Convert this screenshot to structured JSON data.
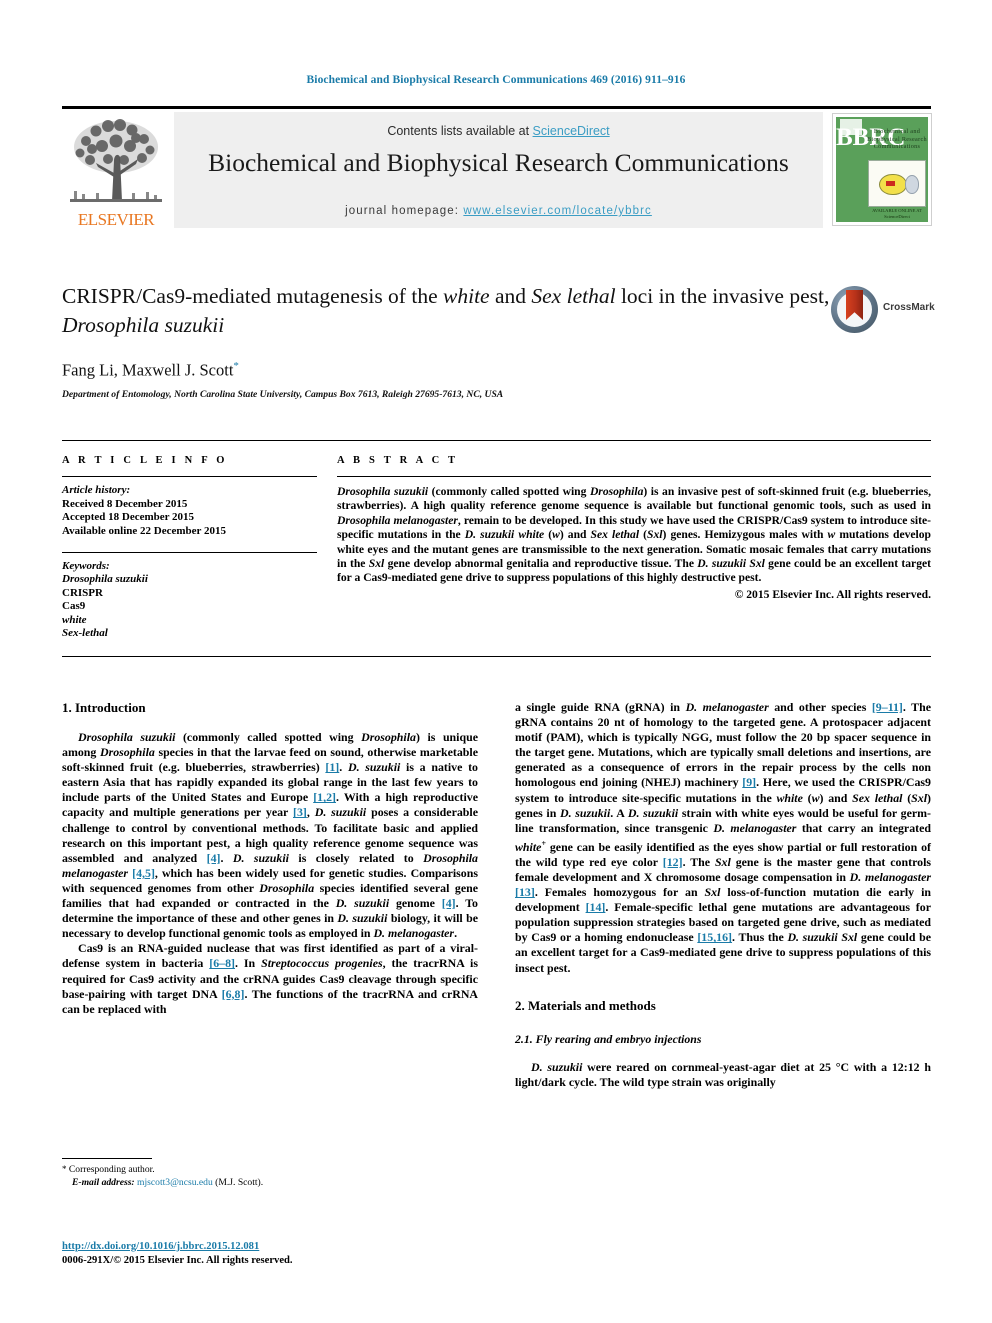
{
  "running_head": "Biochemical and Biophysical Research Communications 469 (2016) 911–916",
  "masthead": {
    "contents_prefix": "Contents lists available at ",
    "sciencedirect": "ScienceDirect",
    "journal_title": "Biochemical and Biophysical Research Communications",
    "homepage_label": "journal homepage:",
    "homepage_url": "www.elsevier.com/locate/ybbrc",
    "publisher_logo_text": "ELSEVIER",
    "cover": {
      "letters": "BBRC",
      "name": "Biochemical and Biophysical Research Communications",
      "footer": "AVAILABLE ONLINE AT\nScienceDirect"
    },
    "accent_color": "#3b9dc4",
    "brand_color": "#e87722"
  },
  "title_block": {
    "title_part1": "CRISPR/Cas9-mediated mutagenesis of the ",
    "title_italic1": "white",
    "title_part2": " and ",
    "title_italic2": "Sex lethal",
    "title_part3": " loci in the invasive pest, ",
    "title_italic3": "Drosophila suzukii",
    "authors": "Fang Li, Maxwell J. Scott",
    "author_marker": "*",
    "affiliation": "Department of Entomology, North Carolina State University, Campus Box 7613, Raleigh 27695-7613, NC, USA",
    "crossmark_label": "CrossMark"
  },
  "article_info": {
    "label": "A R T I C L E    I N F O",
    "history_label": "Article history:",
    "history": [
      "Received 8 December 2015",
      "Accepted 18 December 2015",
      "Available online 22 December 2015"
    ],
    "keywords_label": "Keywords:",
    "keywords": [
      {
        "text": "Drosophila suzukii",
        "italic": true
      },
      {
        "text": "CRISPR",
        "italic": false
      },
      {
        "text": "Cas9",
        "italic": false
      },
      {
        "text": "white",
        "italic": true
      },
      {
        "text": "Sex-lethal",
        "italic": true
      }
    ]
  },
  "abstract": {
    "label": "A B S T R A C T",
    "copyright": "© 2015 Elsevier Inc. All rights reserved.",
    "runs": [
      {
        "t": "Drosophila suzukii",
        "i": true
      },
      {
        "t": " (commonly called spotted wing ",
        "i": false
      },
      {
        "t": "Drosophila",
        "i": true
      },
      {
        "t": ") is an invasive pest of soft-skinned fruit (e.g. blueberries, strawberries). A high quality reference genome sequence is available but functional genomic tools, such as used in ",
        "i": false
      },
      {
        "t": "Drosophila melanogaster",
        "i": true
      },
      {
        "t": ", remain to be developed. In this study we have used the CRISPR/Cas9 system to introduce site-specific mutations in the ",
        "i": false
      },
      {
        "t": "D. suzukii white",
        "i": true
      },
      {
        "t": " (",
        "i": false
      },
      {
        "t": "w",
        "i": true
      },
      {
        "t": ") and ",
        "i": false
      },
      {
        "t": "Sex lethal",
        "i": true
      },
      {
        "t": " (",
        "i": false
      },
      {
        "t": "Sxl",
        "i": true
      },
      {
        "t": ") genes. Hemizygous males with ",
        "i": false
      },
      {
        "t": "w",
        "i": true
      },
      {
        "t": " mutations develop white eyes and the mutant genes are transmissible to the next generation. Somatic mosaic females that carry mutations in the ",
        "i": false
      },
      {
        "t": "Sxl",
        "i": true
      },
      {
        "t": " gene develop abnormal genitalia and reproductive tissue. The ",
        "i": false
      },
      {
        "t": "D. suzukii Sxl",
        "i": true
      },
      {
        "t": " gene could be an excellent target for a Cas9-mediated gene drive to suppress populations of this highly destructive pest.",
        "i": false
      }
    ]
  },
  "body": {
    "left": {
      "heading_1": "1.    Introduction",
      "para_1": [
        {
          "t": "Drosophila suzukii",
          "i": true
        },
        {
          "t": " (commonly called spotted wing ",
          "i": false
        },
        {
          "t": "Drosophila",
          "i": true
        },
        {
          "t": ") is unique among ",
          "i": false
        },
        {
          "t": "Drosophila",
          "i": true
        },
        {
          "t": " species in that the larvae feed on sound, otherwise marketable soft-skinned fruit (e.g. blueberries, strawberries) ",
          "i": false
        },
        {
          "t": "[1]",
          "ref": true
        },
        {
          "t": ". ",
          "i": false
        },
        {
          "t": "D. suzukii",
          "i": true
        },
        {
          "t": " is a native to eastern Asia that has rapidly expanded its global range in the last few years to include parts of the United States and Europe ",
          "i": false
        },
        {
          "t": "[1,2]",
          "ref": true
        },
        {
          "t": ". With a high reproductive capacity and multiple generations per year ",
          "i": false
        },
        {
          "t": "[3]",
          "ref": true
        },
        {
          "t": ", ",
          "i": false
        },
        {
          "t": "D. suzukii",
          "i": true
        },
        {
          "t": " poses a considerable challenge to control by conventional methods. To facilitate basic and applied research on this important pest, a high quality reference genome sequence was assembled and analyzed ",
          "i": false
        },
        {
          "t": "[4]",
          "ref": true
        },
        {
          "t": ". ",
          "i": false
        },
        {
          "t": "D. suzukii",
          "i": true
        },
        {
          "t": " is closely related to ",
          "i": false
        },
        {
          "t": "Drosophila melanogaster",
          "i": true
        },
        {
          "t": " ",
          "i": false
        },
        {
          "t": "[4,5]",
          "ref": true
        },
        {
          "t": ", which has been widely used for genetic studies. Comparisons with sequenced genomes from other ",
          "i": false
        },
        {
          "t": "Drosophila",
          "i": true
        },
        {
          "t": " species identified several gene families that had expanded or contracted in the ",
          "i": false
        },
        {
          "t": "D. suzukii",
          "i": true
        },
        {
          "t": " genome ",
          "i": false
        },
        {
          "t": "[4]",
          "ref": true
        },
        {
          "t": ". To determine the importance of these and other genes in ",
          "i": false
        },
        {
          "t": "D. suzukii",
          "i": true
        },
        {
          "t": " biology, it will be necessary to develop functional genomic tools as employed in ",
          "i": false
        },
        {
          "t": "D. melanogaster",
          "i": true
        },
        {
          "t": ".",
          "i": false
        }
      ],
      "para_2": [
        {
          "t": "Cas9 is an RNA-guided nuclease that was first identified as part of a viral-defense system in bacteria ",
          "i": false
        },
        {
          "t": "[6–8]",
          "ref": true
        },
        {
          "t": ". In ",
          "i": false
        },
        {
          "t": "Streptococcus progenies",
          "i": true
        },
        {
          "t": ", the tracrRNA is required for Cas9 activity and the crRNA guides Cas9 cleavage through specific base-pairing with target DNA ",
          "i": false
        },
        {
          "t": "[6,8]",
          "ref": true
        },
        {
          "t": ". The functions of the tracrRNA and crRNA can be replaced with",
          "i": false
        }
      ]
    },
    "right": {
      "para_1": [
        {
          "t": "a single guide RNA (gRNA) in ",
          "i": false
        },
        {
          "t": "D. melanogaster",
          "i": true
        },
        {
          "t": " and other species ",
          "i": false
        },
        {
          "t": "[9–11]",
          "ref": true
        },
        {
          "t": ". The gRNA contains 20 nt of homology to the targeted gene. A protospacer adjacent motif (PAM), which is typically NGG, must follow the 20 bp spacer sequence in the target gene. Mutations, which are typically small deletions and insertions, are generated as a consequence of errors in the repair process by the cells non homologous end joining (NHEJ) machinery ",
          "i": false
        },
        {
          "t": "[9]",
          "ref": true
        },
        {
          "t": ". Here, we used the CRISPR/Cas9 system to introduce site-specific mutations in the ",
          "i": false
        },
        {
          "t": "white",
          "i": true
        },
        {
          "t": " (",
          "i": false
        },
        {
          "t": "w",
          "i": true
        },
        {
          "t": ") and ",
          "i": false
        },
        {
          "t": "Sex lethal",
          "i": true
        },
        {
          "t": " (",
          "i": false
        },
        {
          "t": "Sxl",
          "i": true
        },
        {
          "t": ") genes in ",
          "i": false
        },
        {
          "t": "D. suzukii",
          "i": true
        },
        {
          "t": ". A ",
          "i": false
        },
        {
          "t": "D. suzukii",
          "i": true
        },
        {
          "t": " strain with white eyes would be useful for germ-line transformation, since transgenic ",
          "i": false
        },
        {
          "t": "D. melanogaster",
          "i": true
        },
        {
          "t": " that carry an integrated ",
          "i": false
        },
        {
          "t": "white",
          "i": true,
          "sup": "+"
        },
        {
          "t": " gene can be easily identified as the eyes show partial or full restoration of the wild type red eye color ",
          "i": false
        },
        {
          "t": "[12]",
          "ref": true
        },
        {
          "t": ". The ",
          "i": false
        },
        {
          "t": "Sxl",
          "i": true
        },
        {
          "t": " gene is the master gene that controls female development and X chromosome dosage compensation in ",
          "i": false
        },
        {
          "t": "D. melanogaster",
          "i": true
        },
        {
          "t": " ",
          "i": false
        },
        {
          "t": "[13]",
          "ref": true
        },
        {
          "t": ". Females homozygous for an ",
          "i": false
        },
        {
          "t": "Sxl",
          "i": true
        },
        {
          "t": " loss-of-function mutation die early in development ",
          "i": false
        },
        {
          "t": "[14]",
          "ref": true
        },
        {
          "t": ". Female-specific lethal gene mutations are advantageous for population suppression strategies based on targeted gene drive, such as mediated by Cas9 or a homing endonuclease ",
          "i": false
        },
        {
          "t": "[15,16]",
          "ref": true
        },
        {
          "t": ". Thus the ",
          "i": false
        },
        {
          "t": "D. suzukii Sxl",
          "i": true
        },
        {
          "t": " gene could be an excellent target for a Cas9-mediated gene drive to suppress populations of this insect pest.",
          "i": false
        }
      ],
      "heading_2": "2.    Materials and methods",
      "subheading_21": "2.1.   Fly rearing and embryo injections",
      "para_2": [
        {
          "t": "D. suzukii",
          "i": true
        },
        {
          "t": " were reared on cornmeal-yeast-agar diet at 25 °C with a 12:12 h light/dark cycle. The wild type strain was originally",
          "i": false
        }
      ]
    }
  },
  "footnote": {
    "star": "*",
    "corresponding": "Corresponding author.",
    "email_label": "E-mail address:",
    "email": "mjscott3@ncsu.edu",
    "email_suffix": "(M.J. Scott)."
  },
  "doi_block": {
    "doi_url": "http://dx.doi.org/10.1016/j.bbrc.2015.12.081",
    "issn_line": "0006-291X/© 2015 Elsevier Inc. All rights reserved."
  }
}
